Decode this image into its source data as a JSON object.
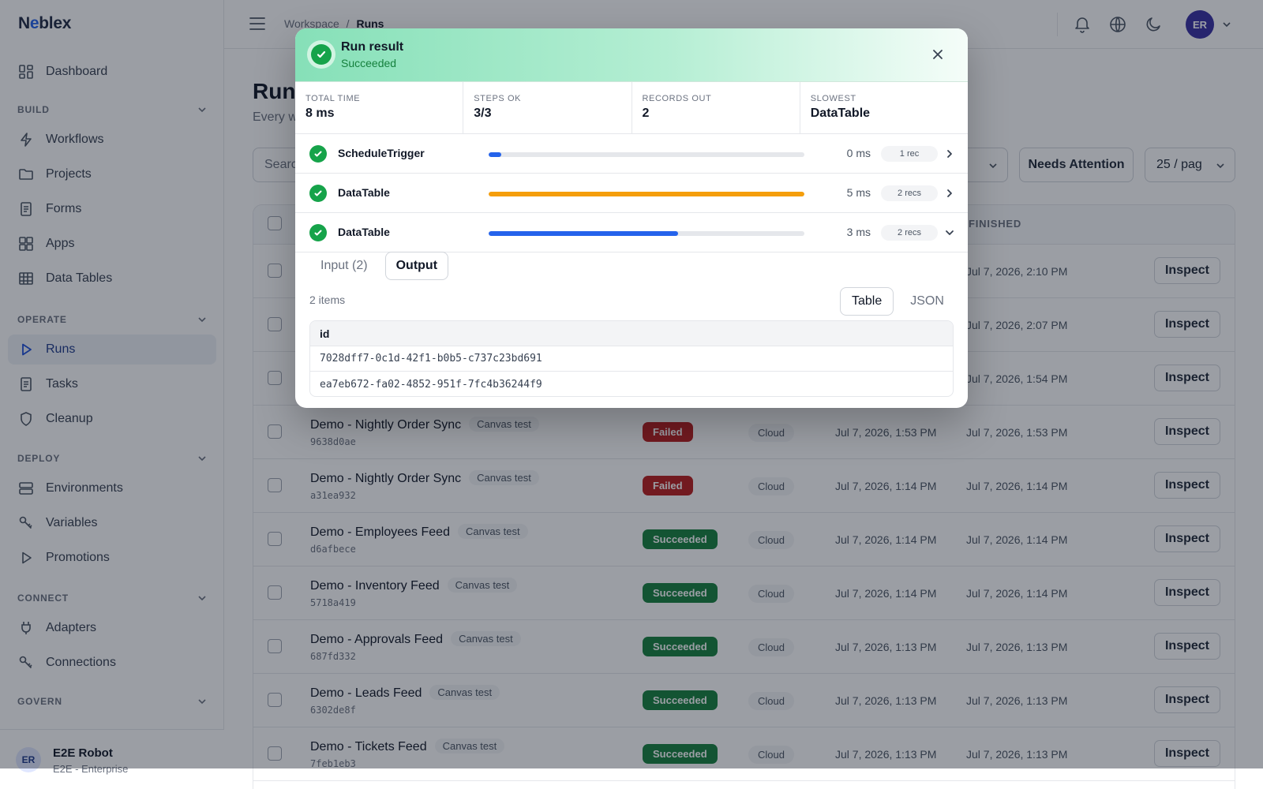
{
  "brand": {
    "pre": "N",
    "accent": "e",
    "post": "blex"
  },
  "sidebar": {
    "dashboard": "Dashboard",
    "sections": {
      "build": "BUILD",
      "operate": "OPERATE",
      "deploy": "DEPLOY",
      "connect": "CONNECT",
      "govern": "GOVERN"
    },
    "items": {
      "workflows": "Workflows",
      "projects": "Projects",
      "forms": "Forms",
      "apps": "Apps",
      "data_tables": "Data Tables",
      "runs": "Runs",
      "tasks": "Tasks",
      "cleanup": "Cleanup",
      "environments": "Environments",
      "variables": "Variables",
      "promotions": "Promotions",
      "adapters": "Adapters",
      "connections": "Connections"
    },
    "user": {
      "initials": "ER",
      "name": "E2E Robot",
      "org": "E2E - Enterprise"
    }
  },
  "topbar": {
    "breadcrumb_root": "Workspace",
    "breadcrumb_sep": "/",
    "breadcrumb_current": "Runs",
    "avatar_initials": "ER"
  },
  "main": {
    "title": "Runs",
    "subtitle": "Every w",
    "search_placeholder": "Searc",
    "needs_attention": "Needs Attention",
    "page_size": "25 / pag",
    "col_finished": "FINISHED",
    "inspect_label": "Inspect",
    "rows": [
      {
        "workflow": "",
        "tag": "",
        "id": "",
        "status": "",
        "env": "",
        "started": "",
        "finished": "Jul 7, 2026, 2:10 PM"
      },
      {
        "workflow": "",
        "tag": "",
        "id": "",
        "status": "",
        "env": "",
        "started": "",
        "finished": "Jul 7, 2026, 2:07 PM"
      },
      {
        "workflow": "",
        "tag": "",
        "id": "",
        "status": "",
        "env": "",
        "started": "",
        "finished": "Jul 7, 2026, 1:54 PM"
      },
      {
        "workflow": "Demo - Nightly Order Sync",
        "tag": "Canvas test",
        "id": "9638d0ae",
        "status": "Failed",
        "env": "Cloud",
        "started": "Jul 7, 2026, 1:53 PM",
        "finished": "Jul 7, 2026, 1:53 PM"
      },
      {
        "workflow": "Demo - Nightly Order Sync",
        "tag": "Canvas test",
        "id": "a31ea932",
        "status": "Failed",
        "env": "Cloud",
        "started": "Jul 7, 2026, 1:14 PM",
        "finished": "Jul 7, 2026, 1:14 PM"
      },
      {
        "workflow": "Demo - Employees Feed",
        "tag": "Canvas test",
        "id": "d6afbece",
        "status": "Succeeded",
        "env": "Cloud",
        "started": "Jul 7, 2026, 1:14 PM",
        "finished": "Jul 7, 2026, 1:14 PM"
      },
      {
        "workflow": "Demo - Inventory Feed",
        "tag": "Canvas test",
        "id": "5718a419",
        "status": "Succeeded",
        "env": "Cloud",
        "started": "Jul 7, 2026, 1:14 PM",
        "finished": "Jul 7, 2026, 1:14 PM"
      },
      {
        "workflow": "Demo - Approvals Feed",
        "tag": "Canvas test",
        "id": "687fd332",
        "status": "Succeeded",
        "env": "Cloud",
        "started": "Jul 7, 2026, 1:13 PM",
        "finished": "Jul 7, 2026, 1:13 PM"
      },
      {
        "workflow": "Demo - Leads Feed",
        "tag": "Canvas test",
        "id": "6302de8f",
        "status": "Succeeded",
        "env": "Cloud",
        "started": "Jul 7, 2026, 1:13 PM",
        "finished": "Jul 7, 2026, 1:13 PM"
      },
      {
        "workflow": "Demo - Tickets Feed",
        "tag": "Canvas test",
        "id": "7feb1eb3",
        "status": "Succeeded",
        "env": "Cloud",
        "started": "Jul 7, 2026, 1:13 PM",
        "finished": "Jul 7, 2026, 1:13 PM"
      }
    ]
  },
  "status_colors": {
    "Failed": "#b91c1c",
    "Succeeded": "#15803d"
  },
  "modal": {
    "title": "Run result",
    "status": "Succeeded",
    "stats": [
      {
        "label": "TOTAL TIME",
        "value": "8 ms"
      },
      {
        "label": "STEPS OK",
        "value": "3/3"
      },
      {
        "label": "RECORDS OUT",
        "value": "2"
      },
      {
        "label": "SLOWEST",
        "value": "DataTable"
      }
    ],
    "steps": [
      {
        "name": "ScheduleTrigger",
        "duration": "0 ms",
        "records": "1 rec",
        "bar_fraction": 0.04,
        "bar_color": "#2563eb",
        "expanded": false
      },
      {
        "name": "DataTable",
        "duration": "5 ms",
        "records": "2 recs",
        "bar_fraction": 1.0,
        "bar_color": "#f59e0b",
        "expanded": false
      },
      {
        "name": "DataTable",
        "duration": "3 ms",
        "records": "2 recs",
        "bar_fraction": 0.6,
        "bar_color": "#2563eb",
        "expanded": true
      }
    ],
    "tabs": {
      "input": "Input (2)",
      "output": "Output"
    },
    "items_count": "2 items",
    "view": {
      "table": "Table",
      "json": "JSON"
    },
    "output_table": {
      "header": "id",
      "rows": [
        "7028dff7-0c1d-42f1-b0b5-c737c23bd691",
        "ea7eb672-fa02-4852-951f-7fc4b36244f9"
      ]
    }
  }
}
